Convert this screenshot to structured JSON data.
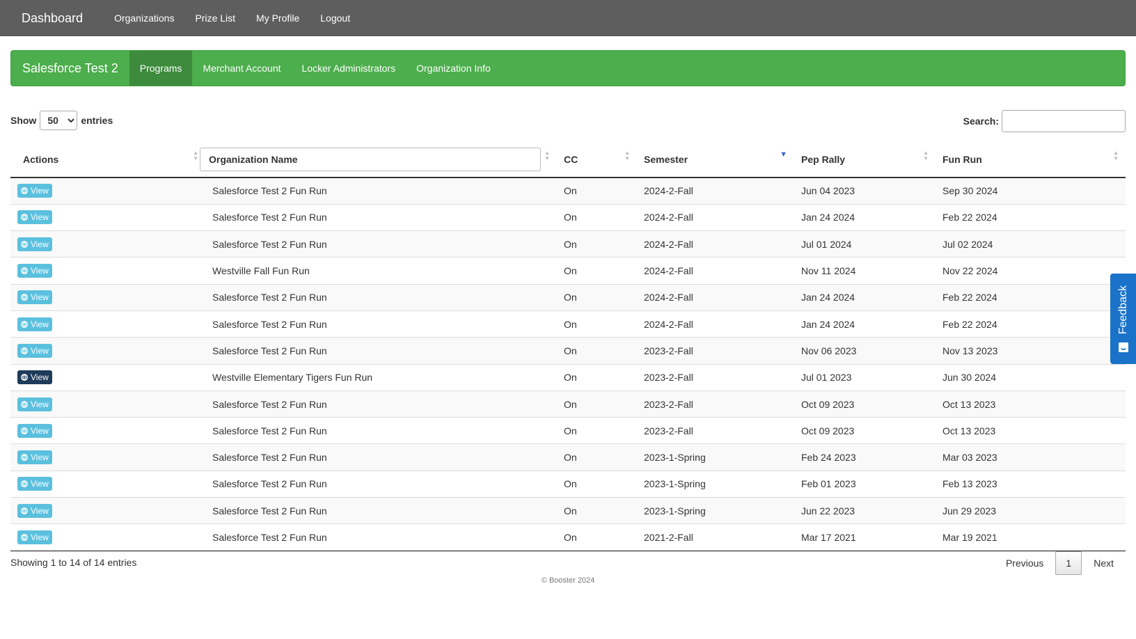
{
  "topnav": {
    "brand": "Dashboard",
    "links": [
      "Organizations",
      "Prize List",
      "My Profile",
      "Logout"
    ]
  },
  "subnav": {
    "brand": "Salesforce Test 2",
    "tabs": [
      "Programs",
      "Merchant Account",
      "Locker Administrators",
      "Organization Info"
    ],
    "active": "Programs"
  },
  "controls": {
    "show_label": "Show",
    "entries_value": "50",
    "entries_label": "entries",
    "search_label": "Search:",
    "search_value": ""
  },
  "table": {
    "headers": {
      "actions": "Actions",
      "org_name": "Organization Name",
      "cc": "CC",
      "semester": "Semester",
      "pep_rally": "Pep Rally",
      "fun_run": "Fun Run"
    },
    "view_label": "View",
    "rows": [
      {
        "org": "Salesforce Test 2 Fun Run",
        "cc": "On",
        "semester": "2024-2-Fall",
        "pep": "Jun 04 2023",
        "fun": "Sep 30 2024"
      },
      {
        "org": "Salesforce Test 2 Fun Run",
        "cc": "On",
        "semester": "2024-2-Fall",
        "pep": "Jan 24 2024",
        "fun": "Feb 22 2024"
      },
      {
        "org": "Salesforce Test 2 Fun Run",
        "cc": "On",
        "semester": "2024-2-Fall",
        "pep": "Jul 01 2024",
        "fun": "Jul 02 2024"
      },
      {
        "org": "Westville Fall Fun Run",
        "cc": "On",
        "semester": "2024-2-Fall",
        "pep": "Nov 11 2024",
        "fun": "Nov 22 2024"
      },
      {
        "org": "Salesforce Test 2 Fun Run",
        "cc": "On",
        "semester": "2024-2-Fall",
        "pep": "Jan 24 2024",
        "fun": "Feb 22 2024"
      },
      {
        "org": "Salesforce Test 2 Fun Run",
        "cc": "On",
        "semester": "2024-2-Fall",
        "pep": "Jan 24 2024",
        "fun": "Feb 22 2024"
      },
      {
        "org": "Salesforce Test 2 Fun Run",
        "cc": "On",
        "semester": "2023-2-Fall",
        "pep": "Nov 06 2023",
        "fun": "Nov 13 2023"
      },
      {
        "org": "Westville Elementary Tigers Fun Run",
        "cc": "On",
        "semester": "2023-2-Fall",
        "pep": "Jul 01 2023",
        "fun": "Jun 30 2024",
        "highlight": true
      },
      {
        "org": "Salesforce Test 2 Fun Run",
        "cc": "On",
        "semester": "2023-2-Fall",
        "pep": "Oct 09 2023",
        "fun": "Oct 13 2023"
      },
      {
        "org": "Salesforce Test 2 Fun Run",
        "cc": "On",
        "semester": "2023-2-Fall",
        "pep": "Oct 09 2023",
        "fun": "Oct 13 2023"
      },
      {
        "org": "Salesforce Test 2 Fun Run",
        "cc": "On",
        "semester": "2023-1-Spring",
        "pep": "Feb 24 2023",
        "fun": "Mar 03 2023"
      },
      {
        "org": "Salesforce Test 2 Fun Run",
        "cc": "On",
        "semester": "2023-1-Spring",
        "pep": "Feb 01 2023",
        "fun": "Feb 13 2023"
      },
      {
        "org": "Salesforce Test 2 Fun Run",
        "cc": "On",
        "semester": "2023-1-Spring",
        "pep": "Jun 22 2023",
        "fun": "Jun 29 2023"
      },
      {
        "org": "Salesforce Test 2 Fun Run",
        "cc": "On",
        "semester": "2021-2-Fall",
        "pep": "Mar 17 2021",
        "fun": "Mar 19 2021"
      }
    ]
  },
  "footer": {
    "info": "Showing 1 to 14 of 14 entries",
    "previous": "Previous",
    "current_page": "1",
    "next": "Next",
    "copyright": "© Booster 2024"
  },
  "feedback": {
    "label": "Feedback",
    "icon": "smiley-icon"
  },
  "colors": {
    "topnav": "#5e5e5e",
    "subnav": "#4cae4c",
    "view_button": "#5bc0de",
    "view_button_active": "#1f3b5a",
    "feedback": "#1a73c9"
  }
}
